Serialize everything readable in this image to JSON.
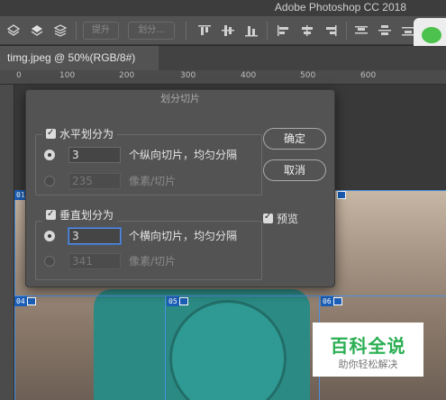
{
  "app": {
    "title": "Adobe Photoshop CC 2018"
  },
  "options_bar": {
    "promote_label": "提升",
    "divide_label": "划分..."
  },
  "document": {
    "tab_label": "timg.jpeg @ 50%(RGB/8#)"
  },
  "ruler": {
    "labels": [
      "0",
      "100",
      "200",
      "300",
      "400",
      "500",
      "600"
    ]
  },
  "slices": {
    "labels": [
      "01",
      "04",
      "05",
      "06"
    ]
  },
  "dialog": {
    "title": "划分切片",
    "horizontal": {
      "checkbox_label": "水平划分为",
      "count_value": "3",
      "count_suffix": "个纵向切片，均匀分隔",
      "pixel_value": "235",
      "pixel_suffix": "像素/切片"
    },
    "vertical": {
      "checkbox_label": "垂直划分为",
      "count_value": "3",
      "count_suffix": "个横向切片，均匀分隔",
      "pixel_value": "341",
      "pixel_suffix": "像素/切片"
    },
    "ok_label": "确定",
    "cancel_label": "取消",
    "preview_label": "预览"
  },
  "watermark": {
    "logo_text": "百科全说",
    "sub_text": "助你轻松解决"
  },
  "colors": {
    "slice_blue": "#1b5fb8",
    "accent_green": "#2aae52"
  }
}
